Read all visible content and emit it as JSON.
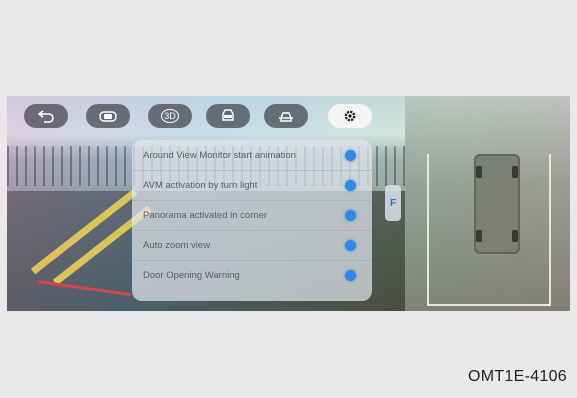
{
  "toolbar": {
    "buttons": [
      {
        "name": "back-button",
        "icon": "back-arrow-icon"
      },
      {
        "name": "camera-view-button",
        "icon": "camera-icon"
      },
      {
        "name": "view-3d-button",
        "icon": "rotate-3d-icon",
        "label": "3D"
      },
      {
        "name": "front-view-button",
        "icon": "car-front-icon"
      },
      {
        "name": "rear-view-button",
        "icon": "car-rear-icon"
      },
      {
        "name": "settings-button",
        "icon": "gear-icon",
        "active": true
      }
    ]
  },
  "settings": {
    "items": [
      {
        "label": "Around View Monitor start animation",
        "enabled": true
      },
      {
        "label": "AVM activation by turn light",
        "enabled": true
      },
      {
        "label": "Panorama activated in corner",
        "enabled": true
      },
      {
        "label": "Auto zoom view",
        "enabled": true
      },
      {
        "label": "Door Opening Warning",
        "enabled": true
      }
    ]
  },
  "side_tab": {
    "label": "F"
  },
  "figure_code": "OMT1E-4106",
  "colors": {
    "toggle_on": "#2f89e6",
    "guide_yellow": "#e6c53a",
    "guide_red": "#e2262a"
  }
}
